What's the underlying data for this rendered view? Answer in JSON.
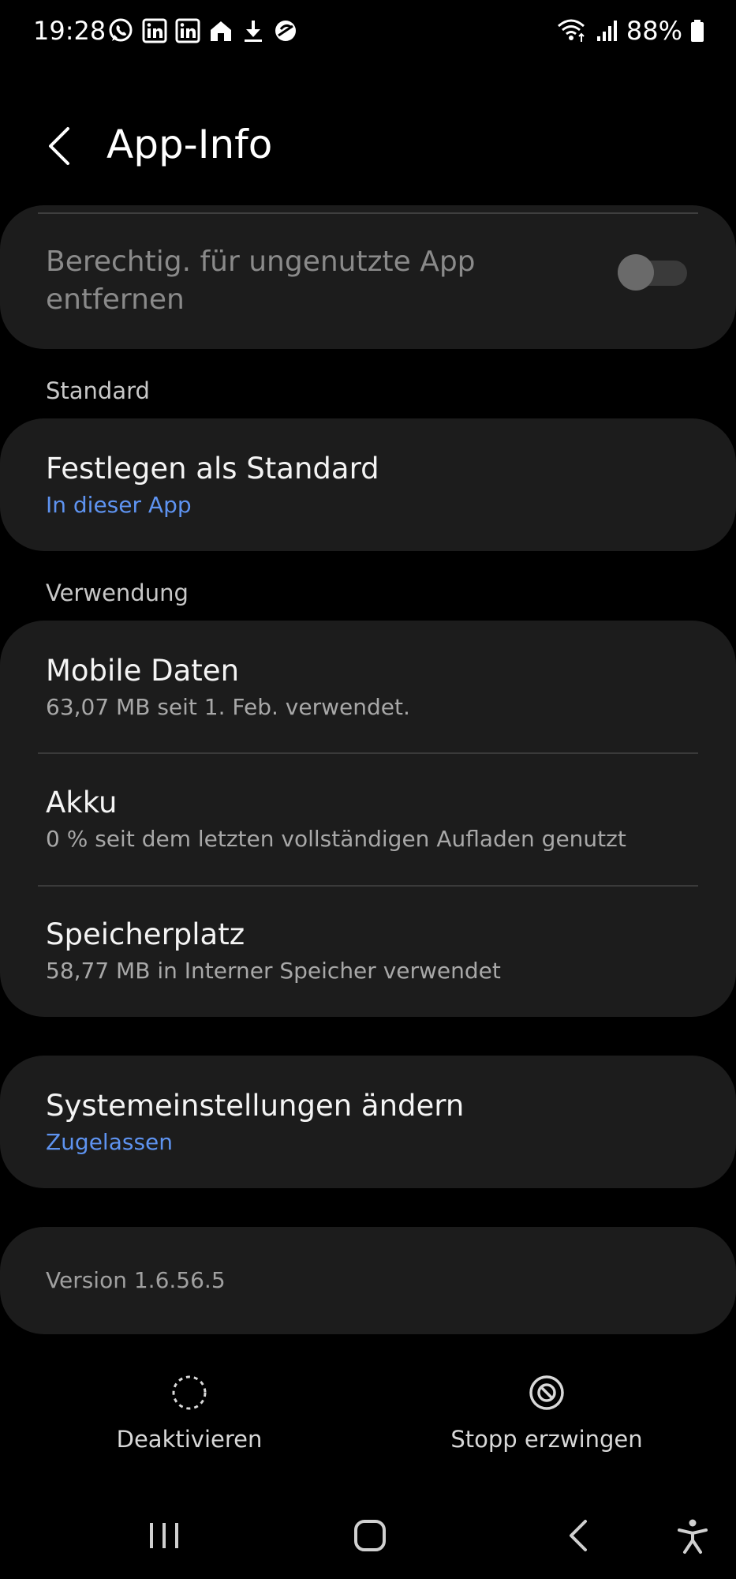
{
  "status_bar": {
    "time": "19:28",
    "battery": "88%",
    "left_icons": [
      "whatsapp-icon",
      "linkedin-icon",
      "linkedin-icon",
      "home-icon",
      "download-icon",
      "sync-off-icon"
    ],
    "right_icons": [
      "wifi-icon",
      "signal-icon",
      "battery-icon"
    ]
  },
  "header": {
    "title": "App-Info"
  },
  "card_unused": {
    "title": "Berechtig. für ungenutzte App entfernen",
    "toggle_on": false
  },
  "section_standard": {
    "label": "Standard",
    "item": {
      "title": "Festlegen als Standard",
      "subtitle": "In dieser App"
    }
  },
  "section_usage": {
    "label": "Verwendung",
    "items": [
      {
        "title": "Mobile Daten",
        "subtitle": "63,07 MB seit 1. Feb. verwendet."
      },
      {
        "title": "Akku",
        "subtitle": "0 % seit dem letzten vollständigen Aufladen genutzt"
      },
      {
        "title": "Speicherplatz",
        "subtitle": "58,77 MB in Interner Speicher verwendet"
      }
    ]
  },
  "system_settings": {
    "title": "Systemeinstellungen ändern",
    "subtitle": "Zugelassen"
  },
  "version": {
    "text": "Version 1.6.56.5"
  },
  "actions": {
    "deactivate": "Deaktivieren",
    "force_stop": "Stopp erzwingen"
  },
  "colors": {
    "background": "#000000",
    "card": "#1c1c1c",
    "accent_blue": "#5e93f0"
  }
}
